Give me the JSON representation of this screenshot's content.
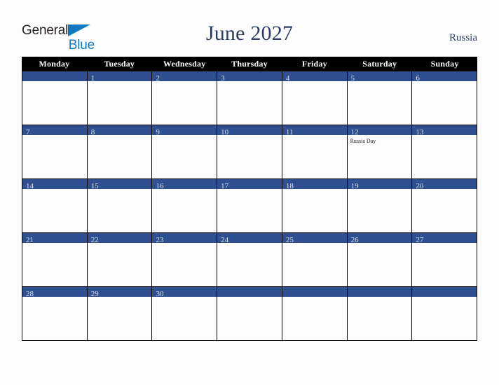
{
  "branding": {
    "logo_text_1": "General",
    "logo_text_2": "Blue",
    "logo_icon": "triangle-flag-icon",
    "color_dark": "#231f20",
    "color_blue": "#1278be"
  },
  "header": {
    "title": "June 2027",
    "country": "Russia"
  },
  "colors": {
    "band_blue": "#2e5090",
    "header_black": "#000000",
    "title_navy": "#2b3c63",
    "page_background": "#fdfdfd"
  },
  "calendar": {
    "day_names": [
      "Monday",
      "Tuesday",
      "Wednesday",
      "Thursday",
      "Friday",
      "Saturday",
      "Sunday"
    ],
    "weeks": [
      [
        {
          "date": "",
          "event": ""
        },
        {
          "date": "1",
          "event": ""
        },
        {
          "date": "2",
          "event": ""
        },
        {
          "date": "3",
          "event": ""
        },
        {
          "date": "4",
          "event": ""
        },
        {
          "date": "5",
          "event": ""
        },
        {
          "date": "6",
          "event": ""
        }
      ],
      [
        {
          "date": "7",
          "event": ""
        },
        {
          "date": "8",
          "event": ""
        },
        {
          "date": "9",
          "event": ""
        },
        {
          "date": "10",
          "event": ""
        },
        {
          "date": "11",
          "event": ""
        },
        {
          "date": "12",
          "event": "Russia Day"
        },
        {
          "date": "13",
          "event": ""
        }
      ],
      [
        {
          "date": "14",
          "event": ""
        },
        {
          "date": "15",
          "event": ""
        },
        {
          "date": "16",
          "event": ""
        },
        {
          "date": "17",
          "event": ""
        },
        {
          "date": "18",
          "event": ""
        },
        {
          "date": "19",
          "event": ""
        },
        {
          "date": "20",
          "event": ""
        }
      ],
      [
        {
          "date": "21",
          "event": ""
        },
        {
          "date": "22",
          "event": ""
        },
        {
          "date": "23",
          "event": ""
        },
        {
          "date": "24",
          "event": ""
        },
        {
          "date": "25",
          "event": ""
        },
        {
          "date": "26",
          "event": ""
        },
        {
          "date": "27",
          "event": ""
        }
      ],
      [
        {
          "date": "28",
          "event": ""
        },
        {
          "date": "29",
          "event": ""
        },
        {
          "date": "30",
          "event": ""
        },
        {
          "date": "",
          "event": ""
        },
        {
          "date": "",
          "event": ""
        },
        {
          "date": "",
          "event": ""
        },
        {
          "date": "",
          "event": ""
        }
      ]
    ]
  }
}
